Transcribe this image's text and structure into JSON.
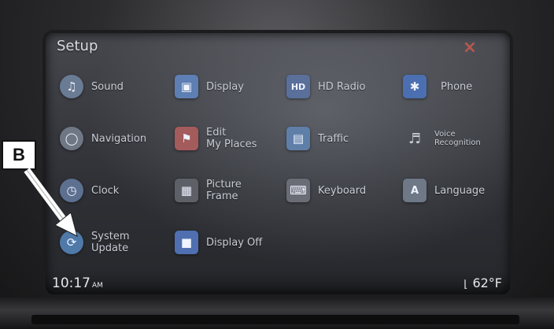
{
  "screen": {
    "title": "Setup",
    "close_glyph": "×"
  },
  "menu": {
    "sound": {
      "label": "Sound",
      "icon": "speaker-icon",
      "color": "#6a7b94"
    },
    "display": {
      "label": "Display",
      "icon": "monitor-icon",
      "color": "#5d7fb3"
    },
    "hd_radio": {
      "label": "HD Radio",
      "icon": "hd-radio-icon",
      "color": "#5a6f9a"
    },
    "phone": {
      "label": "Phone",
      "icon": "bluetooth-icon",
      "color": "#4b6fb0"
    },
    "navigation": {
      "label": "Navigation",
      "icon": "navigation-icon",
      "color": "#707784"
    },
    "edit_my_places": {
      "label_line1": "Edit",
      "label_line2": "My Places",
      "icon": "map-pin-icon",
      "color": "#a35b5b"
    },
    "traffic": {
      "label": "Traffic",
      "icon": "traffic-icon",
      "color": "#5f7fa8"
    },
    "voice_recognition": {
      "label_line1": "Voice",
      "label_line2": "Recognition",
      "icon": "voice-icon",
      "color": "#686c76"
    },
    "clock": {
      "label": "Clock",
      "icon": "clock-icon",
      "color": "#5d7090"
    },
    "picture_frame": {
      "label_line1": "Picture",
      "label_line2": "Frame",
      "icon": "picture-frame-icon",
      "color": "#5e6068"
    },
    "keyboard": {
      "label": "Keyboard",
      "icon": "keyboard-icon",
      "color": "#6a6d75"
    },
    "language": {
      "label": "Language",
      "icon": "language-icon",
      "color": "#6e7886"
    },
    "system_update": {
      "label_line1": "System",
      "label_line2": "Update",
      "icon": "refresh-icon",
      "color": "#4f79a8"
    },
    "display_off": {
      "label": "Display Off",
      "icon": "display-off-icon",
      "color": "#4f6fb0"
    }
  },
  "status": {
    "time": "10:17",
    "ampm": "AM",
    "temperature": "62°F"
  },
  "annotation": {
    "label": "B"
  }
}
